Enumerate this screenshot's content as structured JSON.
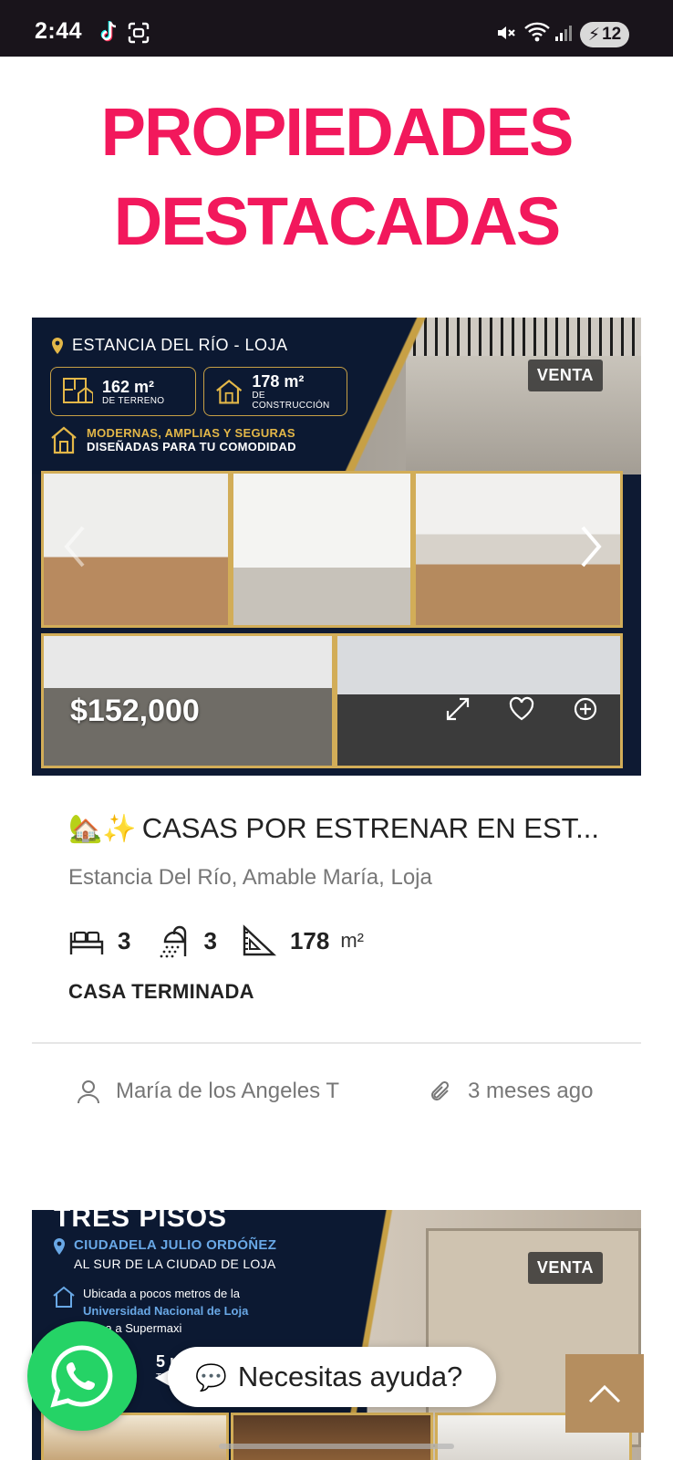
{
  "status_bar": {
    "time": "2:44",
    "battery": "12",
    "icons": [
      "tiktok-icon",
      "screenshot-icon",
      "mute-icon",
      "wifi-icon",
      "signal-icon",
      "battery-icon"
    ]
  },
  "section": {
    "title_line1": "PROPIEDADES",
    "title_line2": "DESTACADAS",
    "title_color": "#f2185c"
  },
  "listings": [
    {
      "badge": "VENTA",
      "price": "$152,000",
      "flyer": {
        "location": "ESTANCIA DEL RÍO - LOJA",
        "terrain_value": "162 m²",
        "terrain_label": "DE TERRENO",
        "construction_value": "178 m²",
        "construction_label": "DE CONSTRUCCIÓN",
        "tagline1": "MODERNAS, AMPLIAS Y SEGURAS",
        "tagline2": "DISEÑADAS PARA TU COMODIDAD"
      },
      "title_emoji": "🏡✨",
      "title": "CASAS POR ESTRENAR EN EST...",
      "address": "Estancia Del Río, Amable María, Loja",
      "bedrooms": "3",
      "bathrooms": "3",
      "area": "178",
      "area_unit": "m²",
      "status": "CASA TERMINADA",
      "author": "María de los Angeles T",
      "date": "3 meses ago"
    },
    {
      "badge": "VENTA",
      "flyer": {
        "title": "TRES PISOS",
        "location_main": "CIUDADELA JULIO ORDÓÑEZ",
        "location_sub": "AL SUR DE LA CIUDAD DE LOJA",
        "info_line1": "Ubicada a pocos metros de la",
        "info_line2": "Universidad Nacional de Loja",
        "info_line3": "cerca a Supermaxi",
        "area_value": "5 m²",
        "area_label": "TERRENO"
      }
    }
  ],
  "floating": {
    "help_emoji": "💬",
    "help_text": "Necesitas ayuda?",
    "whatsapp_color": "#25d366",
    "scroll_top_color": "#b58e5f"
  }
}
